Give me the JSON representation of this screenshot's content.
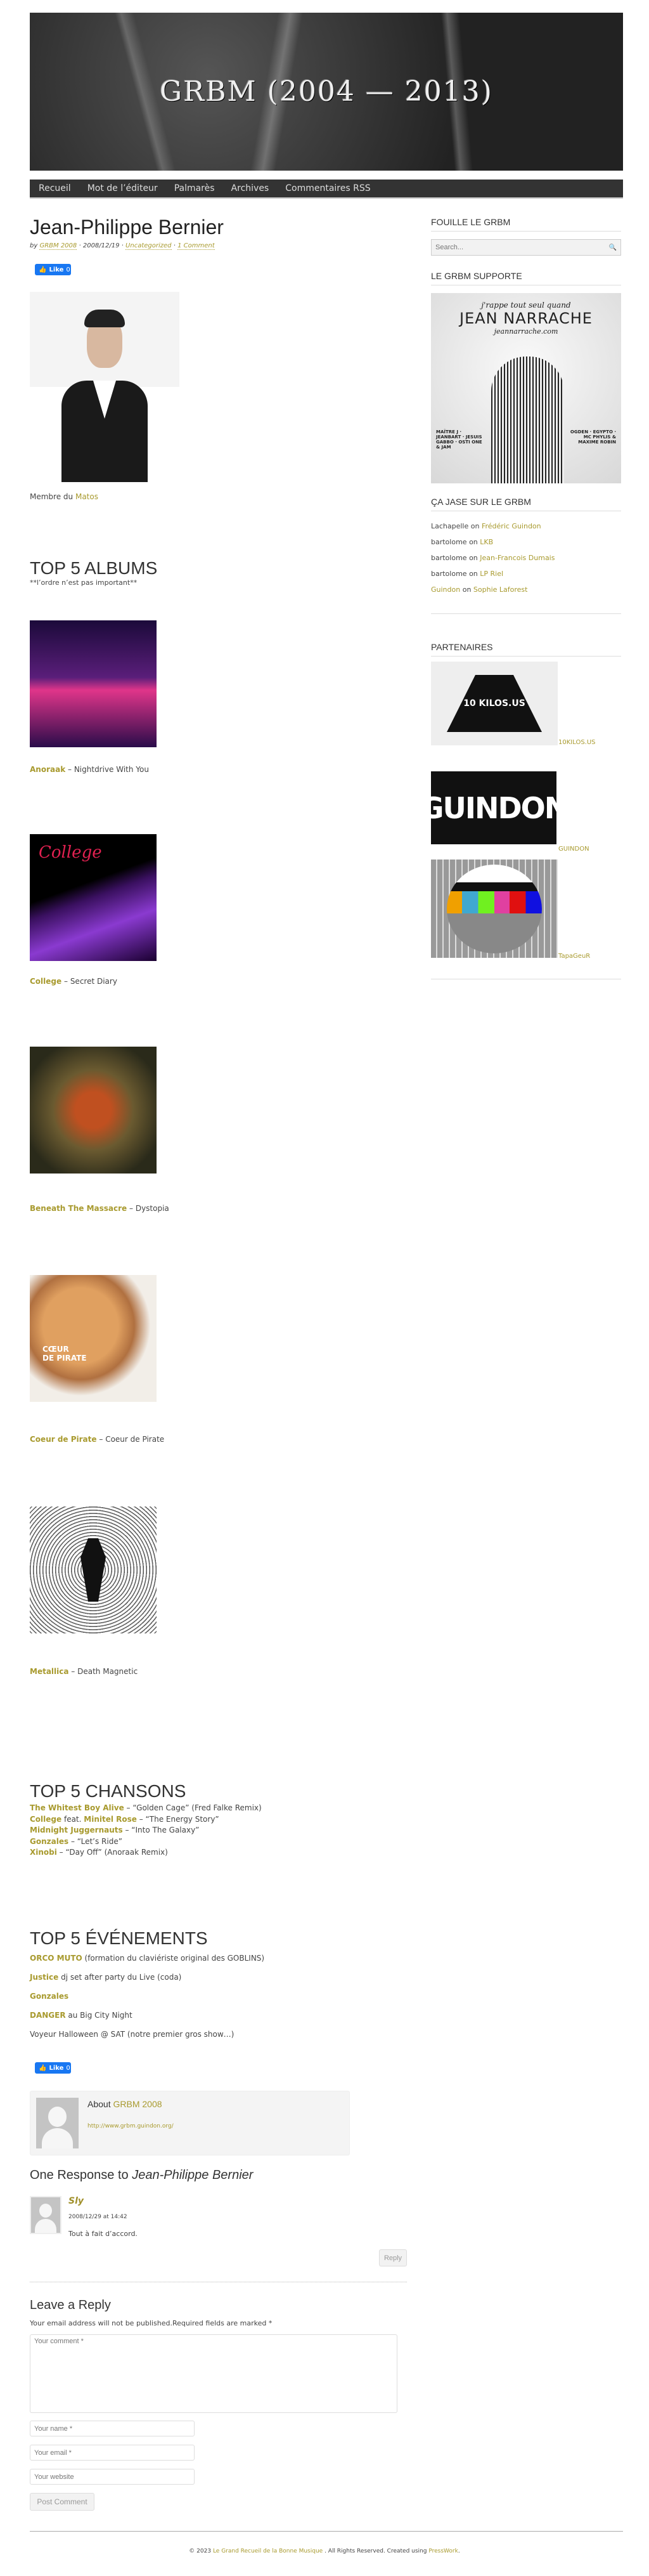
{
  "site": {
    "title": "GRBM (2004 — 2013)"
  },
  "nav": [
    "Recueil",
    "Mot de l’éditeur",
    "Palmarès",
    "Archives",
    "Commentaires RSS"
  ],
  "post": {
    "title": "Jean-Philippe Bernier",
    "meta": {
      "by": "by",
      "author": "GRBM 2008",
      "sep1": "·",
      "date": "2008/12/19",
      "sep2": "·",
      "category": "Uncategorized",
      "sep3": "·",
      "comments": "1 Comment"
    },
    "like": {
      "label": "Like",
      "count": "0"
    },
    "member": {
      "prefix": "Membre du",
      "link": "Matos"
    },
    "albums": {
      "heading": "TOP 5 ALBUMS",
      "note": "**l’ordre n’est pas important**",
      "items": [
        {
          "artist": "Anoraak",
          "title": "Nightdrive With You"
        },
        {
          "artist": "College",
          "title": "Secret Diary"
        },
        {
          "artist": "Beneath The Massacre",
          "title": "Dystopia"
        },
        {
          "artist": "Coeur de Pirate",
          "title": "Coeur de Pirate"
        },
        {
          "artist": "Metallica",
          "title": "Death Magnetic"
        }
      ],
      "dash": "–"
    },
    "songs": {
      "heading": "TOP 5 CHANSONS",
      "items": [
        {
          "a": "The Whitest Boy Alive",
          "mid": "",
          "b": "",
          "rest": " – “Golden Cage” (Fred Falke Remix)"
        },
        {
          "a": "College",
          "mid": " feat. ",
          "b": "Minitel Rose",
          "rest": " – “The Energy Story”"
        },
        {
          "a": "Midnight Juggernauts",
          "mid": "",
          "b": "",
          "rest": " – “Into The Galaxy”"
        },
        {
          "a": "Gonzales",
          "mid": "",
          "b": "",
          "rest": " – “Let’s Ride”"
        },
        {
          "a": "Xinobi",
          "mid": "",
          "b": "",
          "rest": " – “Day Off” (Anoraak Remix)"
        }
      ]
    },
    "events": {
      "heading": "TOP 5 ÉVÉNEMENTS",
      "items": [
        {
          "link": "ORCO MUTO",
          "rest": " (formation du claviériste original des GOBLINS)"
        },
        {
          "link": "Justice",
          "rest": " dj set after party du Live (coda)"
        },
        {
          "link": "Gonzales",
          "rest": ""
        },
        {
          "link": "DANGER",
          "rest": " au Big City Night"
        },
        {
          "link": "",
          "rest": "Voyeur Halloween @ SAT (notre premier gros show…)"
        }
      ]
    }
  },
  "author_box": {
    "prefix": "About",
    "name": "GRBM 2008",
    "url": "http://www.grbm.guindon.org/"
  },
  "comments": {
    "heading_prefix": "One Response to",
    "heading_title": "Jean-Philippe Bernier",
    "items": [
      {
        "author": "Sly",
        "date": "2008/12/29 at 14:42",
        "text": "Tout à fait d’accord.",
        "reply": "Reply"
      }
    ]
  },
  "reply_form": {
    "heading": "Leave a Reply",
    "note": "Your email address will not be published.Required fields are marked *",
    "comment_placeholder": "Your comment *",
    "name_placeholder": "Your name *",
    "email_placeholder": "Your email *",
    "website_placeholder": "Your website",
    "submit": "Post Comment"
  },
  "sidebar": {
    "search": {
      "heading": "FOUILLE LE GRBM",
      "placeholder": "Search..."
    },
    "supports": {
      "heading": "LE GRBM SUPPORTE",
      "poster": {
        "line1": "j'rappe tout seul quand",
        "line2": "JEAN NARRACHE",
        "line3": "jeannarrache.com",
        "left": "MAÎTRE J · JEANBART · JESUIS GABBO · OSTI ONE & JAM",
        "right": "OGDEN · EGYPTO · MC PHYLIS & MAXIME ROBIN"
      }
    },
    "recent_comments": {
      "heading": "ÇA JASE SUR LE GRBM",
      "items": [
        {
          "who": "Lachapelle",
          "who_link": false,
          "on": "on",
          "post": "Frédéric Guindon"
        },
        {
          "who": "bartolome",
          "who_link": false,
          "on": "on",
          "post": "LKB"
        },
        {
          "who": "bartolome",
          "who_link": false,
          "on": "on",
          "post": "Jean-Francois Dumais"
        },
        {
          "who": "bartolome",
          "who_link": false,
          "on": "on",
          "post": "LP Riel"
        },
        {
          "who": "Guindon",
          "who_link": true,
          "on": "on",
          "post": "Sophie Laforest"
        }
      ]
    },
    "partners": {
      "heading": "PARTENAIRES",
      "items": [
        {
          "label": "10KILOS.US",
          "logo_text": "10 KILOS.US"
        },
        {
          "label": "GUINDON",
          "logo_text": "GUINDON"
        },
        {
          "label": "TapaGeuR",
          "logo_text": ""
        }
      ]
    }
  },
  "footer": {
    "copy": "© 2023",
    "site": "Le Grand Recueil de la Bonne Musique",
    "rights": ". All Rights Reserved. Created using",
    "theme": "PressWork",
    "end": "."
  },
  "colors": {
    "link": "#a89a2e",
    "nav": "#333333",
    "like": "#1877f2"
  }
}
